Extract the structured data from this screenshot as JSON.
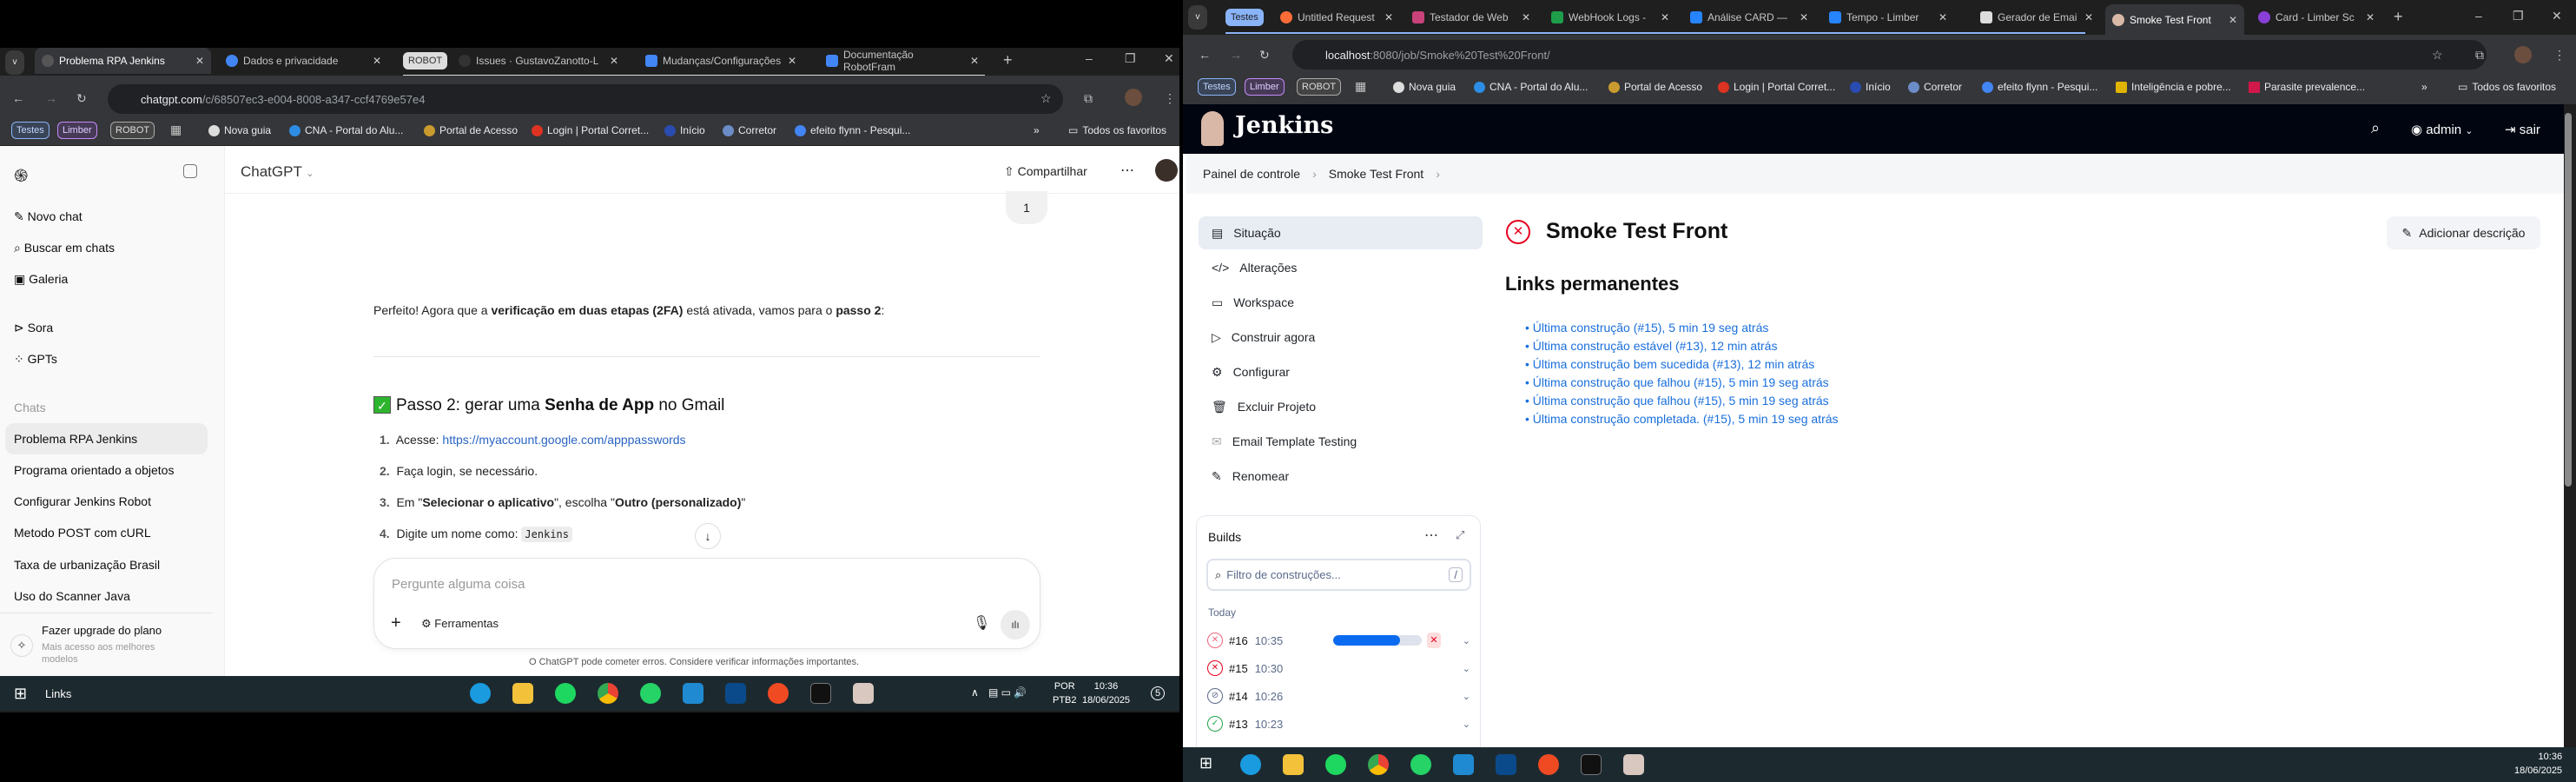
{
  "left_window": {
    "tabs": [
      {
        "label": "Problema RPA Jenkins",
        "active": true
      },
      {
        "label": "Dados e privacidade"
      },
      {
        "label": "Issues · GustavoZanotto-L"
      },
      {
        "label": "Mudanças/Configurações"
      },
      {
        "label": "Documentação RobotFram"
      }
    ],
    "tab_group": "ROBOT",
    "url_host": "chatgpt.com",
    "url_path": "/c/68507ec3-e004-8008-a347-ccf4769e57e4",
    "bookmarks": [
      "Testes",
      "Limber",
      "ROBOT",
      "Nova guia",
      "CNA - Portal do Alu...",
      "Portal de Acesso",
      "Login | Portal Corret...",
      "Início",
      "Corretor",
      "efeito flynn - Pesqui..."
    ],
    "bookmarks_more": "»",
    "all_bookmarks": "Todos os favoritos"
  },
  "chatgpt": {
    "sidebar": {
      "items": [
        "Novo chat",
        "Buscar em chats",
        "Galeria",
        "Sora",
        "GPTs"
      ],
      "section": "Chats",
      "chats": [
        "Problema RPA Jenkins",
        "Programa orientado a objetos",
        "Configurar Jenkins Robot",
        "Metodo POST com cURL",
        "Taxa de urbanização Brasil",
        "Uso do Scanner Java"
      ],
      "upgrade_title": "Fazer upgrade do plano",
      "upgrade_sub": "Mais acesso aos melhores modelos"
    },
    "header": {
      "title": "ChatGPT",
      "share": "Compartilhar"
    },
    "user_bubble": "1",
    "intro": [
      "Perfeito! Agora que a ",
      "verificação em duas etapas (2FA)",
      " está ativada, vamos para o ",
      "passo 2",
      ":"
    ],
    "heading": [
      "Passo 2: gerar uma ",
      "Senha de App",
      " no Gmail"
    ],
    "steps": [
      {
        "n": "1.",
        "text": "Acesse: ",
        "link": "https://myaccount.google.com/apppasswords"
      },
      {
        "n": "2.",
        "text": "Faça login, se necessário."
      },
      {
        "n": "3.",
        "pre": "Em \"",
        "b1": "Selecionar o aplicativo",
        "mid": "\", escolha \"",
        "b2": "Outro (personalizado)",
        "post": "\""
      },
      {
        "n": "4.",
        "text": "Digite um nome como: ",
        "code": "Jenkins"
      }
    ],
    "composer": {
      "placeholder": "Pergunte alguma coisa",
      "tools": "Ferramentas"
    },
    "disclaimer": "O ChatGPT pode cometer erros. Considere verificar informações importantes."
  },
  "left_taskbar": {
    "search_label": "Links",
    "lang1": "POR",
    "lang2": "PTB2",
    "time": "10:36",
    "date": "18/06/2025",
    "notifications": "5"
  },
  "right_window": {
    "tab_group": "Testes",
    "tabs": [
      {
        "label": "Untitled Request"
      },
      {
        "label": "Testador de Web"
      },
      {
        "label": "WebHook Logs -"
      },
      {
        "label": "Análise CARD —"
      },
      {
        "label": "Tempo - Limber"
      },
      {
        "label": "Gerador de Emai"
      },
      {
        "label": "Smoke Test Front",
        "active": true
      },
      {
        "label": "Card - Limber Sc"
      }
    ],
    "url_host": "localhost",
    "url_path": ":8080/job/Smoke%20Test%20Front/",
    "bookmarks": [
      "Testes",
      "Limber",
      "ROBOT",
      "Nova guia",
      "CNA - Portal do Alu...",
      "Portal de Acesso",
      "Login | Portal Corret...",
      "Início",
      "Corretor",
      "efeito flynn - Pesqui...",
      "Inteligência e pobre...",
      "Parasite prevalence..."
    ],
    "bookmarks_more": "»",
    "all_bookmarks": "Todos os favoritos"
  },
  "jenkins": {
    "brand": "Jenkins",
    "user": "admin",
    "logout": "sair",
    "breadcrumb": [
      "Painel de controle",
      "Smoke Test Front"
    ],
    "sidebar": [
      "Situação",
      "Alterações",
      "Workspace",
      "Construir agora",
      "Configurar",
      "Excluir Projeto",
      "Email Template Testing",
      "Renomear"
    ],
    "title": "Smoke Test Front",
    "status": "failed",
    "add_description": "Adicionar descrição",
    "permalinks_title": "Links permanentes",
    "permalinks": [
      "Última construção (#15), 5 min 19 seg atrás",
      "Última construção estável (#13), 12 min atrás",
      "Última construção bem sucedida (#13), 12 min atrás",
      "Última construção que falhou (#15), 5 min 19 seg atrás",
      "Última construção que falhou (#15), 5 min 19 seg atrás",
      "Última construção completada. (#15), 5 min 19 seg atrás"
    ],
    "builds": {
      "title": "Builds",
      "filter_placeholder": "Filtro de construções...",
      "shortcut": "/",
      "group": "Today",
      "rows": [
        {
          "id": "#16",
          "time": "10:35",
          "status": "running",
          "progress": 0.75
        },
        {
          "id": "#15",
          "time": "10:30",
          "status": "failed"
        },
        {
          "id": "#14",
          "time": "10:26",
          "status": "aborted"
        },
        {
          "id": "#13",
          "time": "10:23",
          "status": "success"
        }
      ]
    }
  },
  "right_taskbar": {
    "time": "10:36",
    "date": "18/06/2025"
  },
  "colors": {
    "link": "#1a6fdc",
    "failed": "#e6001f",
    "success": "#1ea64b",
    "jenkins_header": "#000510",
    "progress": "#0b6bf0"
  }
}
